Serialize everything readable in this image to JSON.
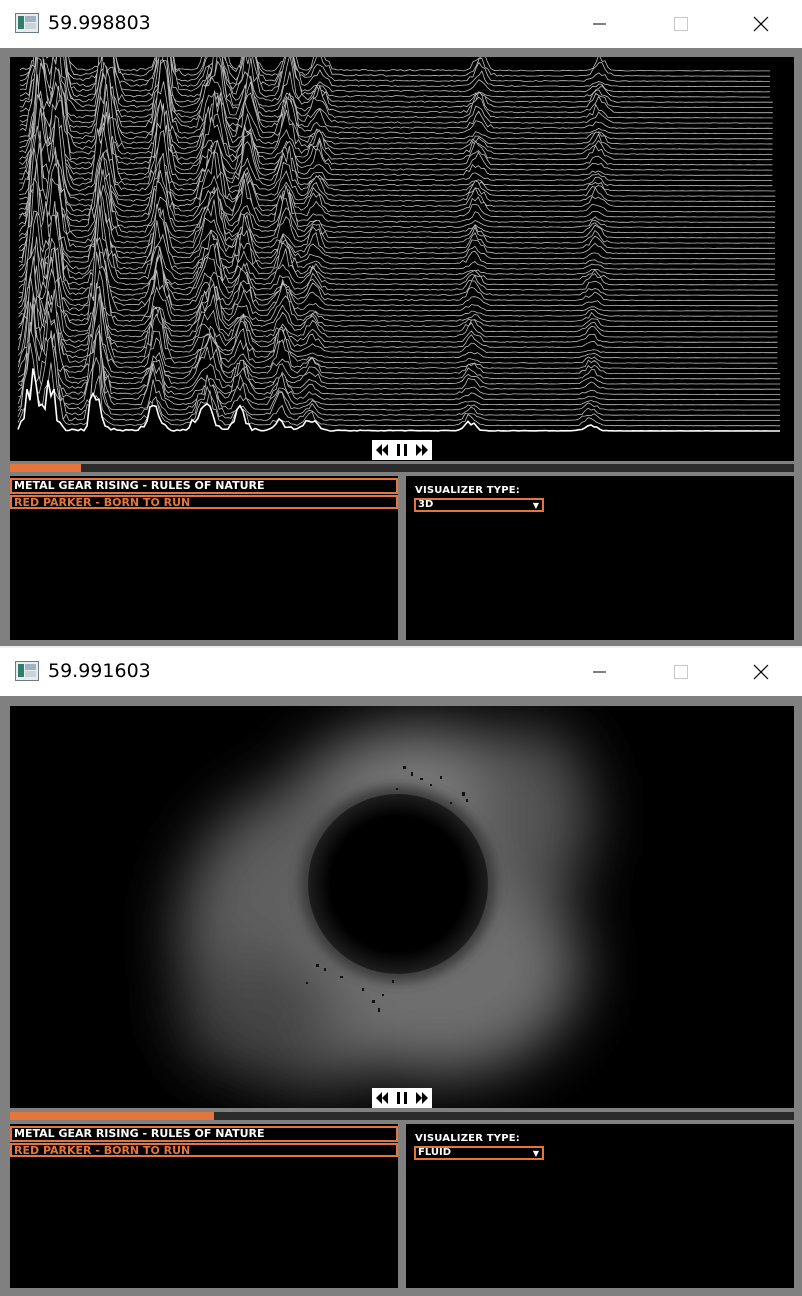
{
  "windows": [
    {
      "title": "59.998803",
      "playlist": [
        "METAL GEAR RISING - RULES OF NATURE",
        "RED PARKER - BORN TO RUN"
      ],
      "visualizer_label": "VISUALIZER TYPE:",
      "visualizer_value": "3D",
      "progress": 0.09
    },
    {
      "title": "59.991603",
      "playlist": [
        "METAL GEAR RISING - RULES OF NATURE",
        "RED PARKER - BORN TO RUN"
      ],
      "visualizer_label": "VISUALIZER TYPE:",
      "visualizer_value": "FLUID",
      "progress": 0.26
    }
  ],
  "colors": {
    "accent": "#e5763b",
    "panel_bg": "#000000",
    "frame": "#808080"
  },
  "icons": [
    "app-icon",
    "minimize-icon",
    "maximize-icon",
    "close-icon",
    "rewind-icon",
    "pause-icon",
    "fast-forward-icon",
    "chevron-down-icon"
  ]
}
